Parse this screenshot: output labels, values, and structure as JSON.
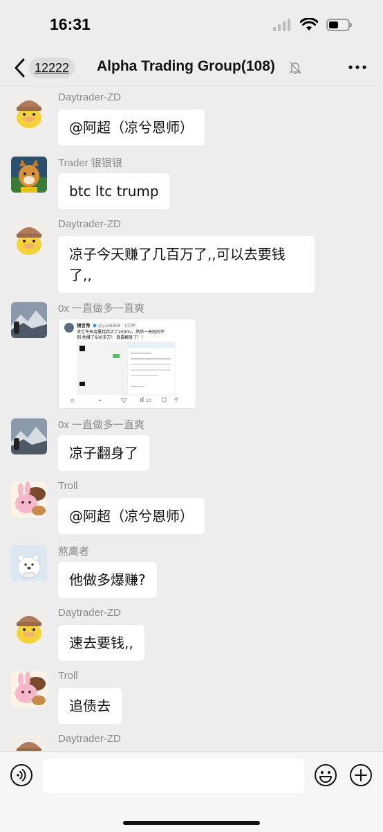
{
  "status_bar": {
    "time": "16:31"
  },
  "nav": {
    "unread_count": "12222",
    "title": "Alpha Trading Group",
    "member_count": "(108)"
  },
  "messages": [
    {
      "sender": "Daytrader-ZD",
      "text": "@阿超（凉兮恩师）",
      "avatar": "yellow-duck-avatar"
    },
    {
      "sender": "Trader 银银银",
      "text": "btc ltc trump",
      "avatar": "cartoon-fox-avatar"
    },
    {
      "sender": "Daytrader-ZD",
      "text_line1": "凉子今天赚了几百万了,,可以去要钱",
      "text_line2": "了,,",
      "avatar": "yellow-duck-avatar"
    },
    {
      "sender": "0x 一直做多一直爽",
      "avatar": "mountain-photo-avatar",
      "image": {
        "author": "预言帝",
        "handle": "@yyd8888 · 1分钟",
        "line1": "凉兮今天凌晨找我买了2000u，然后一天时间不",
        "line2": "到 他赚了600多万！ 真要翻身了！！",
        "views": "10"
      }
    },
    {
      "sender": "0x 一直做多一直爽",
      "text": "凉子翻身了",
      "avatar": "mountain-photo-avatar"
    },
    {
      "sender": "Troll",
      "text": "@阿超（凉兮恩师）",
      "avatar": "pink-rabbit-avatar"
    },
    {
      "sender": "熬鹰者",
      "text": "他做多爆赚?",
      "avatar": "polar-bear-avatar"
    },
    {
      "sender": "Daytrader-ZD",
      "text": "速去要钱,,",
      "avatar": "yellow-duck-avatar"
    },
    {
      "sender": "Troll",
      "text": "追债去",
      "avatar": "pink-rabbit-avatar"
    },
    {
      "sender": "Daytrader-ZD",
      "avatar": "yellow-duck-avatar"
    }
  ],
  "input": {
    "placeholder": ""
  },
  "colors": {
    "background": "#ededed",
    "bubble": "#ffffff",
    "sender_name": "#8a8a8a"
  }
}
